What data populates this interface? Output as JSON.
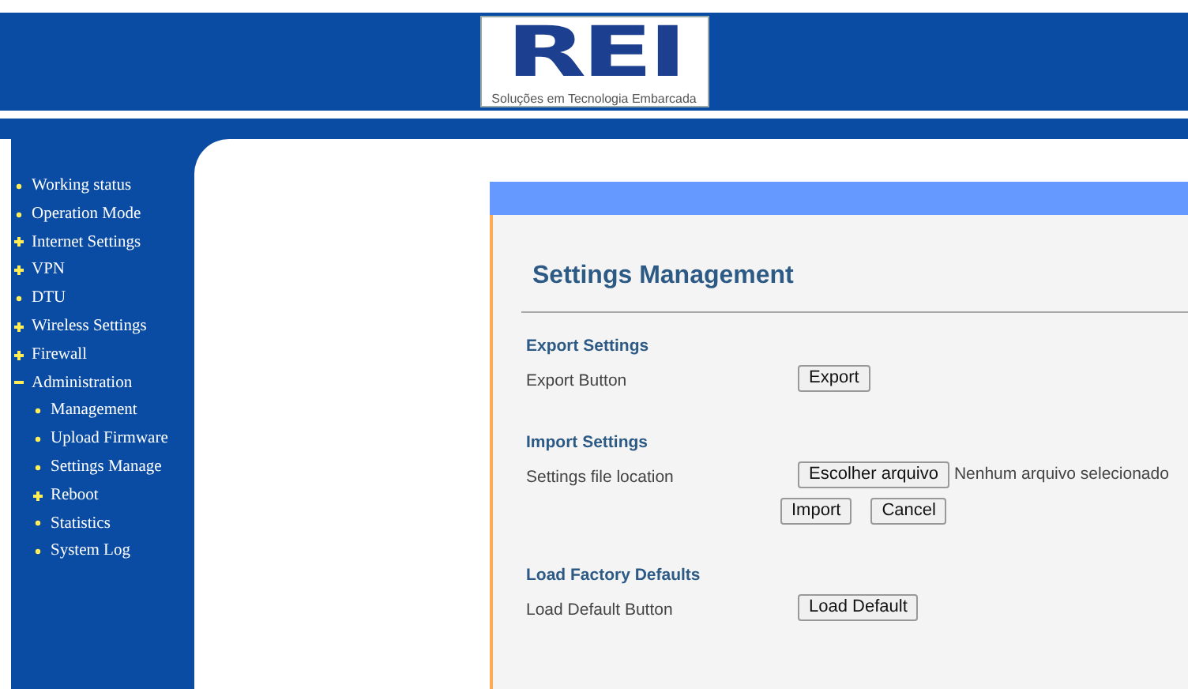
{
  "header": {
    "logo_text": "REI",
    "tagline": "Soluções em Tecnologia Embarcada"
  },
  "sidebar": {
    "items": [
      {
        "label": "Working status",
        "kind": "link"
      },
      {
        "label": "Operation Mode",
        "kind": "link"
      },
      {
        "label": "Internet Settings",
        "kind": "group",
        "expanded": false
      },
      {
        "label": "VPN",
        "kind": "group",
        "expanded": false
      },
      {
        "label": "DTU",
        "kind": "link"
      },
      {
        "label": "Wireless Settings",
        "kind": "group",
        "expanded": false
      },
      {
        "label": "Firewall",
        "kind": "group",
        "expanded": false
      },
      {
        "label": "Administration",
        "kind": "group",
        "expanded": true,
        "children": [
          {
            "label": "Management",
            "kind": "link"
          },
          {
            "label": "Upload Firmware",
            "kind": "link"
          },
          {
            "label": "Settings Manage",
            "kind": "link"
          },
          {
            "label": "Reboot",
            "kind": "group",
            "expanded": false
          },
          {
            "label": "Statistics",
            "kind": "link"
          },
          {
            "label": "System Log",
            "kind": "link"
          }
        ]
      }
    ]
  },
  "page": {
    "title": "Settings Management",
    "sections": [
      {
        "heading": "Export Settings",
        "rows": [
          {
            "label": "Export Button",
            "kind": "buttons",
            "buttons": [
              "Export"
            ]
          }
        ]
      },
      {
        "heading": "Import Settings",
        "rows": [
          {
            "label": "Settings file location",
            "kind": "file",
            "button": "Escolher arquivo",
            "status": "Nenhum arquivo selecionado"
          },
          {
            "kind": "buttons",
            "buttons": [
              "Import",
              "Cancel"
            ]
          }
        ]
      },
      {
        "heading": "Load Factory Defaults",
        "rows": [
          {
            "label": "Load Default Button",
            "kind": "buttons",
            "buttons": [
              "Load Default"
            ]
          }
        ]
      }
    ]
  }
}
